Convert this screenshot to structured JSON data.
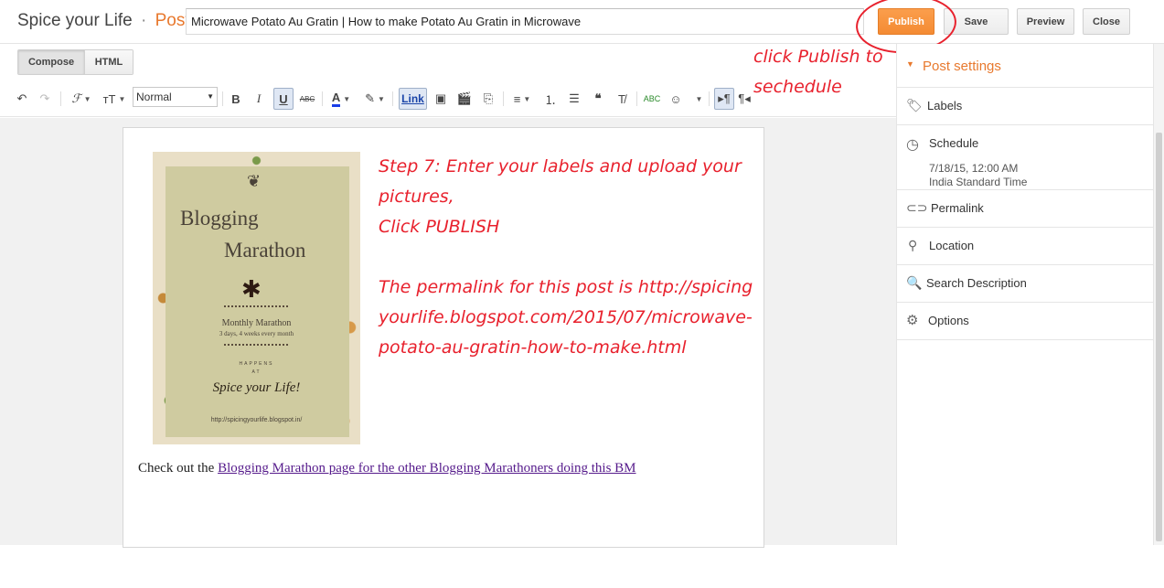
{
  "header": {
    "blog_name": "Spice your Life",
    "separator": "·",
    "section": "Post",
    "post_title": "Microwave Potato Au Gratin | How to make Potato Au Gratin in Microwave",
    "publish_label": "Publish",
    "save_label": "Save",
    "preview_label": "Preview",
    "close_label": "Close"
  },
  "modes": {
    "compose": "Compose",
    "html": "HTML"
  },
  "toolbar": {
    "font_size_value": "Normal",
    "link_label": "Link",
    "underline_label": "U",
    "bold_label": "B",
    "italic_label": "I",
    "strike_label": "ABC",
    "spellcheck_label": "ABC"
  },
  "annotation": {
    "line1": "click Publish to",
    "line2": "sechedule"
  },
  "content": {
    "step_lines": [
      "Step 7: Enter your labels and upload your pictures,",
      "Click PUBLISH",
      "The permalink for this post is http://spicingyourlife.blogspot.com/2015/07/microwave-potato-au-gratin-how-to-make.html"
    ],
    "checkout_prefix": "Check out the",
    "checkout_link": "Blogging Marathon page for the other Blogging Marathoners doing this BM"
  },
  "poster": {
    "line1": "Blogging",
    "line2": "Marathon",
    "monthly": "Monthly Marathon",
    "subline": "3 days, 4 weeks every month",
    "happens": "HAPPENS",
    "at": "AT",
    "spice": "Spice your Life!",
    "url": "http://spicingyourlife.blogspot.in/"
  },
  "sidebar": {
    "post_settings": "Post settings",
    "labels": "Labels",
    "schedule": "Schedule",
    "schedule_date": "7/18/15, 12:00 AM",
    "schedule_tz": "India Standard Time",
    "permalink": "Permalink",
    "location": "Location",
    "search_description": "Search Description",
    "options": "Options"
  },
  "colors": {
    "accent_orange": "#e8792e",
    "publish_button": "#f48b33",
    "annotation_red": "#e8212d",
    "link_visited": "#551a8b"
  }
}
